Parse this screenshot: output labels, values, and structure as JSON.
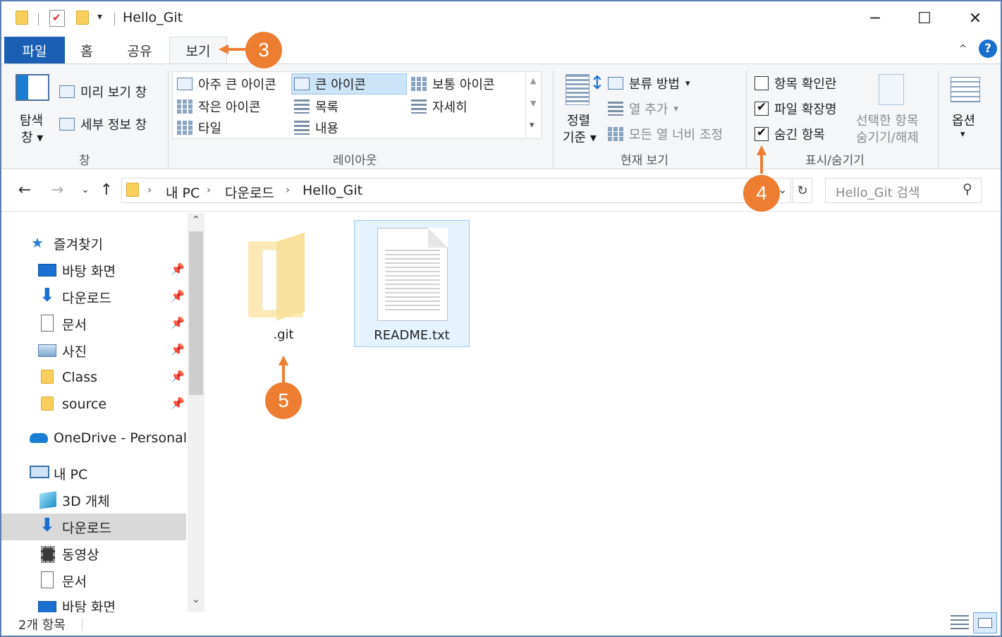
{
  "window": {
    "title": "Hello_Git",
    "controls": {
      "minimize": "─",
      "maximize": "☐",
      "close": "✕"
    }
  },
  "tabs": [
    {
      "label": "파일"
    },
    {
      "label": "홈"
    },
    {
      "label": "공유"
    },
    {
      "label": "보기"
    }
  ],
  "ribbon": {
    "pane": {
      "nav_pane_line1": "탐색",
      "nav_pane_line2": "창",
      "preview_pane": "미리 보기 창",
      "details_pane": "세부 정보 창",
      "group_label": "창"
    },
    "layout": {
      "options": [
        "아주 큰 아이콘",
        "큰 아이콘",
        "보통 아이콘",
        "작은 아이콘",
        "목록",
        "자세히",
        "타일",
        "내용"
      ],
      "selected": "큰 아이콘",
      "group_label": "레이아웃"
    },
    "current_view": {
      "sort_line1": "정렬",
      "sort_line2": "기준",
      "group_by": "분류 방법",
      "add_columns": "열 추가",
      "size_all_columns": "모든 열 너비 조정",
      "group_label": "현재 보기"
    },
    "show_hide": {
      "item_checkboxes": {
        "label": "항목 확인란",
        "checked": false
      },
      "file_extensions": {
        "label": "파일 확장명",
        "checked": true
      },
      "hidden_items": {
        "label": "숨긴 항목",
        "checked": true
      },
      "hide_selected_line1": "선택한 항목",
      "hide_selected_line2": "숨기기/해제",
      "group_label": "표시/숨기기"
    },
    "options_label": "옵션"
  },
  "address": {
    "crumbs": [
      "내 PC",
      "다운로드",
      "Hello_Git"
    ],
    "search_placeholder": "Hello_Git 검색"
  },
  "nav": {
    "quick_access": "즐겨찾기",
    "pinned": [
      "바탕 화면",
      "다운로드",
      "문서",
      "사진",
      "Class",
      "source"
    ],
    "onedrive": "OneDrive - Personal",
    "this_pc": "내 PC",
    "pc_items": [
      "3D 개체",
      "다운로드",
      "동영상",
      "문서",
      "바탕 화면"
    ],
    "selected": "다운로드"
  },
  "files": [
    {
      "name": ".git",
      "type": "folder"
    },
    {
      "name": "README.txt",
      "type": "text"
    }
  ],
  "status": {
    "item_count": "2개 항목"
  },
  "callouts": [
    "3",
    "4",
    "5"
  ],
  "colors": {
    "accent": "#1a5fb4",
    "callout": "#ed7d31",
    "selection": "#cce4f7"
  }
}
